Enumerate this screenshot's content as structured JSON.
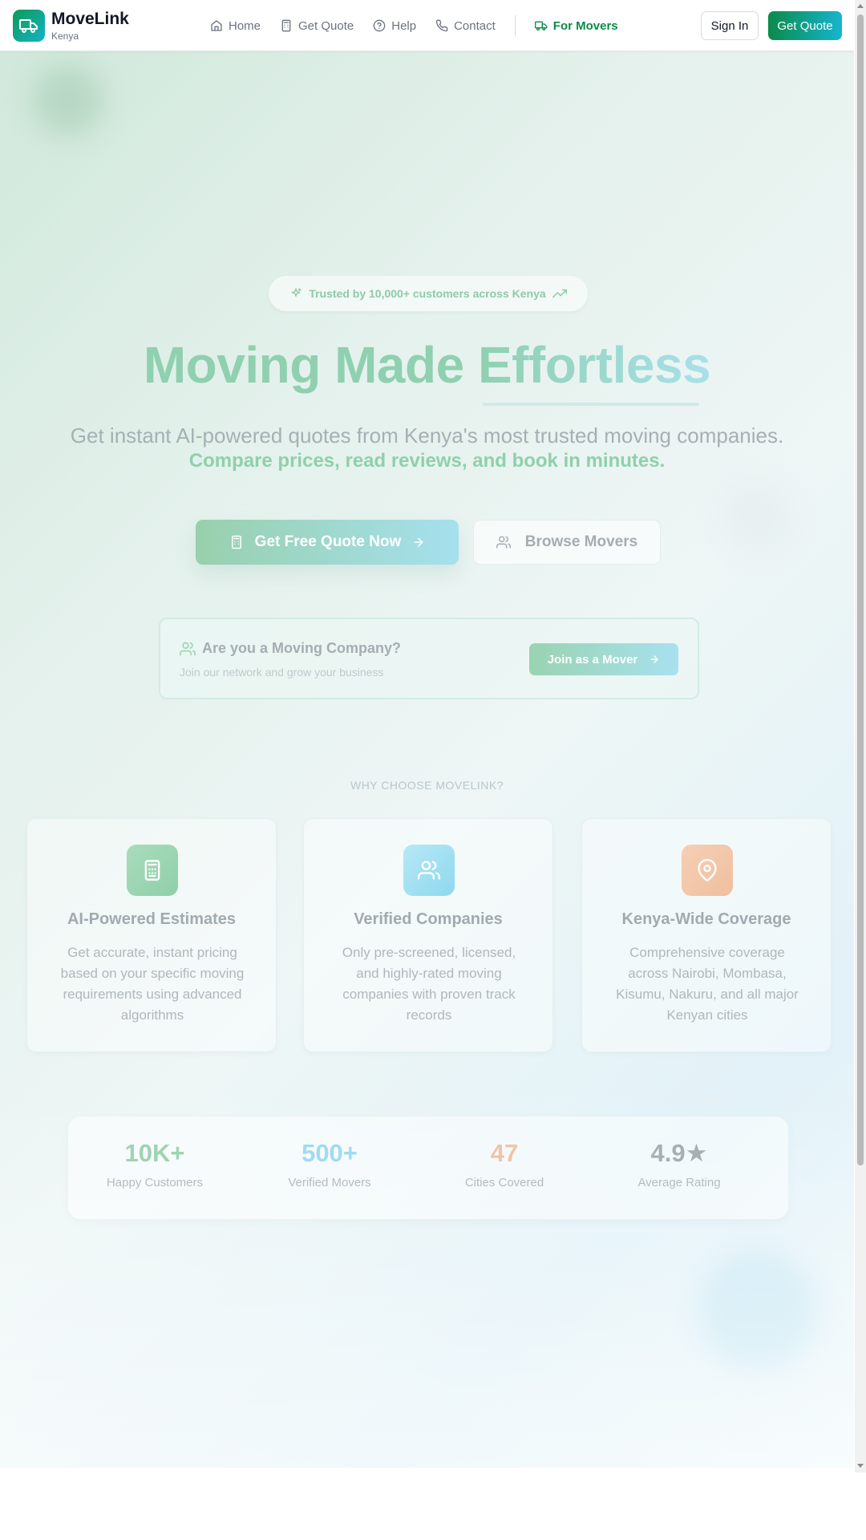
{
  "header": {
    "brand": "MoveLink",
    "brand_sub": "Kenya",
    "nav": [
      {
        "label": "Home",
        "icon": "home-icon"
      },
      {
        "label": "Get Quote",
        "icon": "calculator-icon"
      },
      {
        "label": "Help",
        "icon": "help-circle-icon"
      },
      {
        "label": "Contact",
        "icon": "phone-icon"
      }
    ],
    "movers_label": "For Movers",
    "signin_label": "Sign In",
    "getquote_label": "Get Quote"
  },
  "hero": {
    "trusted_badge": "Trusted by 10,000+ customers across Kenya",
    "title_plain": "Moving Made ",
    "title_highlight": "Effortless",
    "subtitle": "Get instant AI-powered quotes from Kenya's most trusted moving companies.",
    "subtitle_strong": "Compare prices, read reviews, and book in minutes.",
    "primary_cta": "Get Free Quote Now",
    "secondary_cta": "Browse Movers"
  },
  "mover_card": {
    "title": "Are you a Moving Company?",
    "subtitle": "Join our network and grow your business",
    "button": "Join as a Mover"
  },
  "features": {
    "section_label": "WHY CHOOSE MOVELINK?",
    "items": [
      {
        "title": "AI-Powered Estimates",
        "text": "Get accurate, instant pricing based on your specific moving requirements using advanced algorithms",
        "icon": "calculator-icon"
      },
      {
        "title": "Verified Companies",
        "text": "Only pre-screened, licensed, and highly-rated moving companies with proven track records",
        "icon": "users-icon"
      },
      {
        "title": "Kenya-Wide Coverage",
        "text": "Comprehensive coverage across Nairobi, Mombasa, Kisumu, Nakuru, and all major Kenyan cities",
        "icon": "map-pin-icon"
      }
    ]
  },
  "stats": [
    {
      "value": "10K+",
      "label": "Happy Customers",
      "color": "#9fd3b4"
    },
    {
      "value": "500+",
      "label": "Verified Movers",
      "color": "#9fdcef"
    },
    {
      "value": "47",
      "label": "Cities Covered",
      "color": "#f2c4a4"
    },
    {
      "value": "4.9★",
      "label": "Average Rating",
      "color": "#a7afb3"
    }
  ],
  "colors": {
    "brand_green": "#0c8a4a",
    "brand_cyan": "#16b5d0"
  }
}
